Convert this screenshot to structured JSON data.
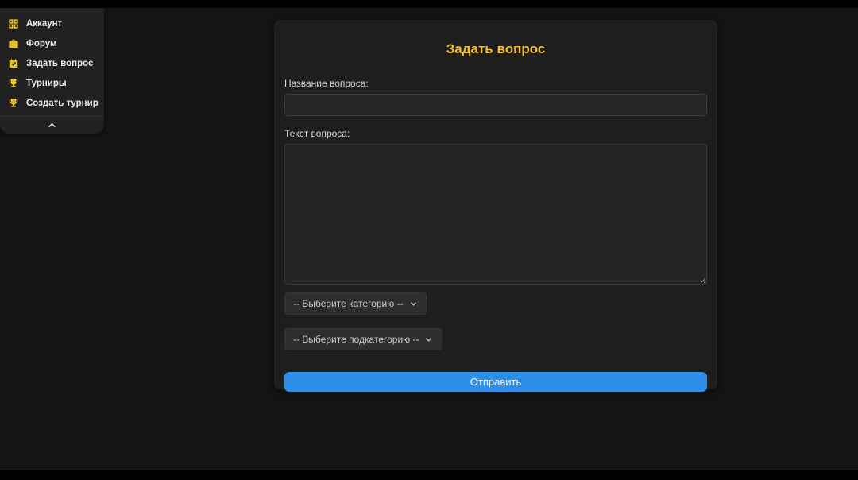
{
  "colors": {
    "page_background": "#141414",
    "sidebar_background": "#212121",
    "card_background": "#1e1e1e",
    "accent_yellow": "#f0c12f",
    "button_blue": "#2e8fe9"
  },
  "sidebar": {
    "items": [
      {
        "label": "Аккаунт",
        "icon": "grid-icon"
      },
      {
        "label": "Форум",
        "icon": "briefcase-icon"
      },
      {
        "label": "Задать вопрос",
        "icon": "clipboard-check-icon"
      },
      {
        "label": "Турниры",
        "icon": "trophy-icon"
      },
      {
        "label": "Создать турнир",
        "icon": "trophy-icon"
      }
    ],
    "collapse_icon": "chevron-up-icon"
  },
  "form": {
    "title": "Задать вопрос",
    "question_title_label": "Название вопроса:",
    "question_title_value": "",
    "question_text_label": "Текст вопроса:",
    "question_text_value": "",
    "category_selected": "-- Выберите категорию --",
    "subcategory_selected": "-- Выберите подкатегорию --",
    "submit_label": "Отправить"
  }
}
